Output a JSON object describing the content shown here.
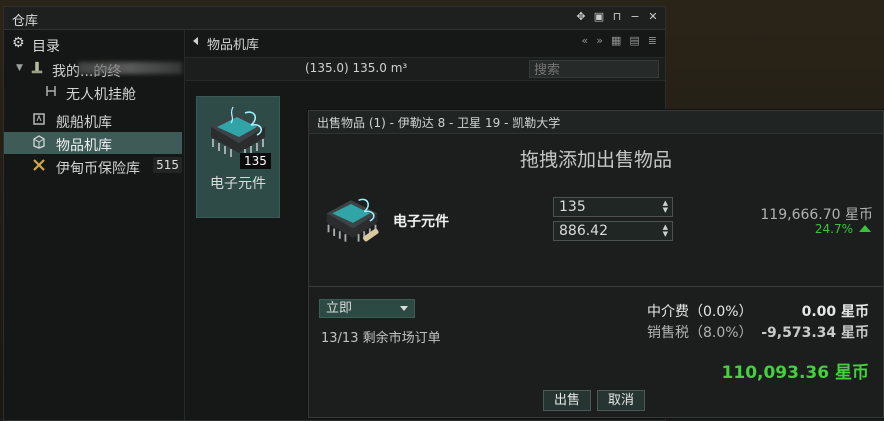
{
  "inventory": {
    "title": "仓库",
    "window_controls": [
      "move-icon",
      "compact-icon",
      "pin-icon",
      "minimize-icon",
      "close-icon"
    ],
    "directory_label": "目录",
    "tree": [
      {
        "label": "我的...的终",
        "icon": "structure-icon",
        "expanded": true
      },
      {
        "label": "无人机挂舱",
        "icon": "drone-bay-icon"
      },
      {
        "label": "舰船机库",
        "icon": "ship-hangar-icon"
      },
      {
        "label": "物品机库",
        "icon": "item-hangar-icon",
        "selected": true
      },
      {
        "label": "伊甸币保险库",
        "icon": "isk-vault-icon",
        "badge": "515"
      }
    ],
    "location_title": "物品机库",
    "capacity": "(135.0) 135.0 m³",
    "search_placeholder": "搜索",
    "items": [
      {
        "name": "电子元件",
        "quantity": "135",
        "icon": "electronic-component-icon"
      }
    ]
  },
  "sell_dialog": {
    "title": "出售物品 (1) - 伊勒达 8 - 卫星 19 - 凯勒大学",
    "drop_hint": "拖拽添加出售物品",
    "item_name": "电子元件",
    "quantity": "135",
    "price": "886.42",
    "total": "119,666.70 星币",
    "change_pct": "24.7%",
    "duration": "立即",
    "orders_remaining": "13/13 剩余市场订单",
    "broker_fee_label": "中介费（0.0%）",
    "broker_fee_value": "0.00 星币",
    "sales_tax_label": "销售税（8.0%）",
    "sales_tax_value": "-9,573.34 星币",
    "net_total": "110,093.36 星币",
    "sell_button": "出售",
    "cancel_button": "取消",
    "colors": {
      "positive": "#37c43a",
      "selected_row": "#3e5b57"
    }
  }
}
